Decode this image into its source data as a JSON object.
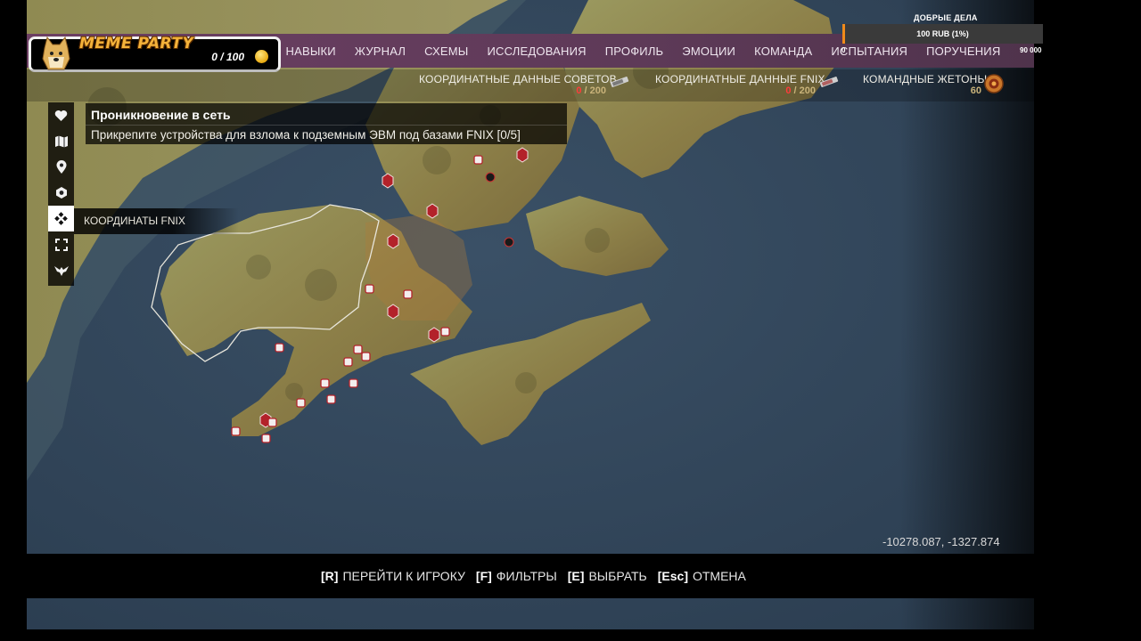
{
  "brand": {
    "name": "MEME PARTY",
    "currency_value": "0 / 100",
    "coin_icon": "coin-icon",
    "avatar_icon": "doge-avatar-icon"
  },
  "good_deeds": {
    "label": "ДОБРЫЕ ДЕЛА",
    "value_text": "100 RUB (1%)",
    "min": "0",
    "max": "90 000",
    "progress": 0.01,
    "fill_color": "#f08a1a"
  },
  "nav": {
    "items": [
      "НАВЫКИ",
      "ЖУРНАЛ",
      "СХЕМЫ",
      "ИССЛЕДОВАНИЯ",
      "ПРОФИЛЬ",
      "ЭМОЦИИ",
      "КОМАНДА",
      "ИСПЫТАНИЯ",
      "ПОРУЧЕНИЯ"
    ]
  },
  "resources": [
    {
      "name": "КООРДИНАТНЫЕ ДАННЫЕ СОВЕТОВ",
      "current": "0",
      "total": " / 200",
      "icon": "data-stick-icon"
    },
    {
      "name": "КООРДИНАТНЫЕ ДАННЫЕ FNIX",
      "current": "0",
      "total": " / 200",
      "icon": "data-stick-icon"
    },
    {
      "name": "КОМАНДНЫЕ ЖЕТОНЫ",
      "current": "",
      "total": "60",
      "icon": "token-icon"
    }
  ],
  "tools": {
    "icons": [
      "heart-icon",
      "map-icon",
      "location-pin-icon",
      "hexagon-icon",
      "fnix-coordinates-icon",
      "focus-frame-icon",
      "winged-emblem-icon"
    ],
    "active_label": "КООРДИНАТЫ FNIX"
  },
  "mission": {
    "title": "Проникновение в сеть",
    "description": "Прикрепите устройства для взлома к подземным ЭВМ под базами FNIX [0/5]"
  },
  "map": {
    "cursor_coordinates": "-10278.087, -1327.874"
  },
  "hints": [
    {
      "key": "[R]",
      "label": "ПЕРЕЙТИ К ИГРОКУ"
    },
    {
      "key": "[F]",
      "label": "ФИЛЬТРЫ"
    },
    {
      "key": "[E]",
      "label": "ВЫБРАТЬ"
    },
    {
      "key": "[Esc]",
      "label": "ОТМЕНА"
    }
  ],
  "colors": {
    "accent_nav": "#6c3f63",
    "marker_red": "#b3222a",
    "water": "#33475c",
    "land": "#8a8750"
  }
}
